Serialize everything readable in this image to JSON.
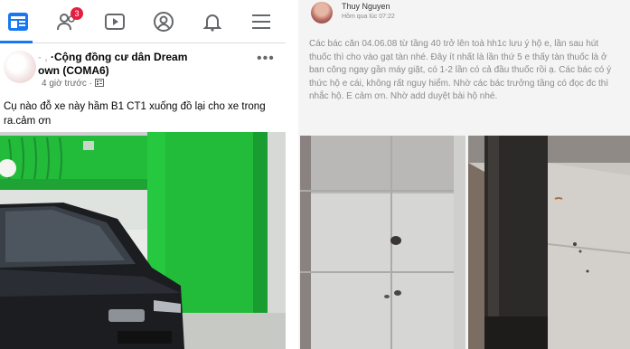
{
  "left_post": {
    "nav": {
      "icons": [
        "home-icon",
        "friends-icon",
        "watch-icon",
        "profile-icon",
        "notifications-icon",
        "menu-icon"
      ],
      "friends_badge": "3"
    },
    "group_line1": "·Cộng đồng cư dân Dream",
    "group_line2": "own (COMA6)",
    "author_fragment": "- ,",
    "time": "4 giờ trước ·",
    "text": "Cụ nào đỗ xe này hầm B1 CT1 xuống đồ lại cho xe trong ra.cảm ơn"
  },
  "right_post": {
    "name": "Thuy Nguyen",
    "time": "Hôm qua lúc 07:22",
    "text": "Các bác căn 04.06.08 từ tầng 40 trở lên toà hh1c lưu ý hộ e, lần sau hút thuốc thì cho vào gạt tàn nhé. Đây ít nhất là lần thứ 5 e thấy tàn thuốc là ở ban công ngay gần máy giặt, có 1-2 lần có cả đầu thuốc rồi ạ. Các bác có ý thức hộ e cái, không rất nguy hiểm. Nhờ các bác trưởng tầng có đọc đc thì nhắc hộ. E cảm ơn. Nhờ add duyệt bài hộ nhé."
  },
  "colors": {
    "accent": "#1877f2",
    "badge": "#e41e3f",
    "wall_green": "#22bb3a"
  }
}
